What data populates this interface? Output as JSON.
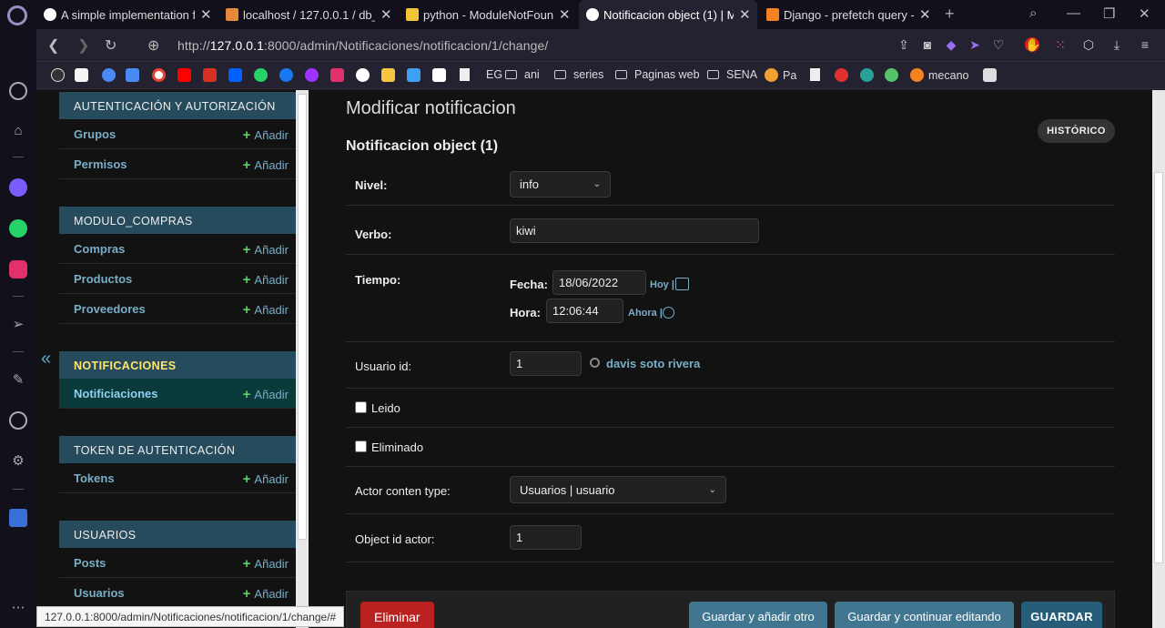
{
  "tabs": [
    {
      "title": "A simple implementation fo",
      "favicon_color": "#ffffff"
    },
    {
      "title": "localhost / 127.0.0.1 / db_e",
      "favicon_color": "#e8883a"
    },
    {
      "title": "python - ModuleNotFound",
      "favicon_color": "#f3c33a"
    },
    {
      "title": "Notificacion object (1) | Mo",
      "favicon_color": "#ffffff"
    },
    {
      "title": "Django - prefetch query - C",
      "favicon_color": "#f48024"
    }
  ],
  "address": {
    "scheme": "http://",
    "host": "127.0.0.1",
    "rest": ":8000/admin/Notificaciones/notificacion/1/change/"
  },
  "bookmarks": [
    {
      "label": "",
      "color": "#e03131"
    },
    {
      "label": "",
      "color": "#f5f5f5"
    },
    {
      "label": "",
      "color": "#4a8af4"
    },
    {
      "label": "",
      "color": "#4a8af4"
    },
    {
      "label": "",
      "color": "#ea4335"
    },
    {
      "label": "",
      "color": "#ff0000"
    },
    {
      "label": "",
      "color": "#d93025"
    },
    {
      "label": "",
      "color": "#0061fe"
    },
    {
      "label": "",
      "color": "#25d366"
    },
    {
      "label": "",
      "color": "#1877f2"
    },
    {
      "label": "",
      "color": "#a033ff"
    },
    {
      "label": "",
      "color": "#e1306c"
    },
    {
      "label": "",
      "color": "#ffffff"
    },
    {
      "label": "",
      "color": "#f5c542"
    },
    {
      "label": "",
      "color": "#3ea0f0"
    },
    {
      "label": "",
      "color": "#ffffff"
    },
    {
      "label": "EG",
      "kind": "doc"
    },
    {
      "label": "ani",
      "kind": "folder"
    },
    {
      "label": "series",
      "kind": "folder"
    },
    {
      "label": "Paginas web",
      "kind": "folder"
    },
    {
      "label": "SENA",
      "kind": "folder"
    },
    {
      "label": "Pa",
      "color": "#f0a030"
    },
    {
      "label": "",
      "kind": "doc"
    },
    {
      "label": "",
      "color": "#e03131"
    },
    {
      "label": "",
      "color": "#2aa198"
    },
    {
      "label": "",
      "color": "#56c26b"
    },
    {
      "label": "mecano",
      "color": "#f58220"
    },
    {
      "label": "",
      "color": "#dddddd"
    }
  ],
  "nav": {
    "modules": [
      {
        "caption": "AUTENTICACIÓN Y AUTORIZACIÓN",
        "current": false,
        "rows": [
          {
            "label": "Grupos",
            "add": "Añadir"
          },
          {
            "label": "Permisos",
            "add": "Añadir"
          }
        ]
      },
      {
        "caption": "MODULO_COMPRAS",
        "current": false,
        "rows": [
          {
            "label": "Compras",
            "add": "Añadir"
          },
          {
            "label": "Productos",
            "add": "Añadir"
          },
          {
            "label": "Proveedores",
            "add": "Añadir"
          }
        ]
      },
      {
        "caption": "NOTIFICACIONES",
        "current": true,
        "rows": [
          {
            "label": "Notificiaciones",
            "add": "Añadir"
          }
        ]
      },
      {
        "caption": "TOKEN DE AUTENTICACIÓN",
        "current": false,
        "rows": [
          {
            "label": "Tokens",
            "add": "Añadir"
          }
        ]
      },
      {
        "caption": "USUARIOS",
        "current": false,
        "rows": [
          {
            "label": "Posts",
            "add": "Añadir"
          },
          {
            "label": "Usuarios",
            "add": "Añadir"
          }
        ]
      }
    ],
    "toggle": "«"
  },
  "content": {
    "title": "Modificar notificacion",
    "history": "HISTÓRICO",
    "object_title": "Notificacion object (1)"
  },
  "form": {
    "nivel": {
      "label": "Nivel:",
      "value": "info"
    },
    "verbo": {
      "label": "Verbo:",
      "value": "kiwi"
    },
    "tiempo": {
      "label": "Tiempo:",
      "fecha_label": "Fecha:",
      "fecha": "18/06/2022",
      "hoy": "Hoy |",
      "hora_label": "Hora:",
      "hora": "12:06:44",
      "ahora": "Ahora |"
    },
    "usuario": {
      "label": "Usuario id:",
      "value": "1",
      "related": "davis soto rivera"
    },
    "leido": {
      "label": "Leido"
    },
    "eliminado": {
      "label": "Eliminado"
    },
    "actor_type": {
      "label": "Actor conten type:",
      "value": "Usuarios | usuario"
    },
    "actor_id": {
      "label": "Object id actor:",
      "value": "1"
    }
  },
  "buttons": {
    "delete": "Eliminar",
    "save_add": "Guardar y añadir otro",
    "save_continue": "Guardar y continuar editando",
    "save": "GUARDAR"
  },
  "status_url": "127.0.0.1:8000/admin/Notificaciones/notificacion/1/change/#"
}
